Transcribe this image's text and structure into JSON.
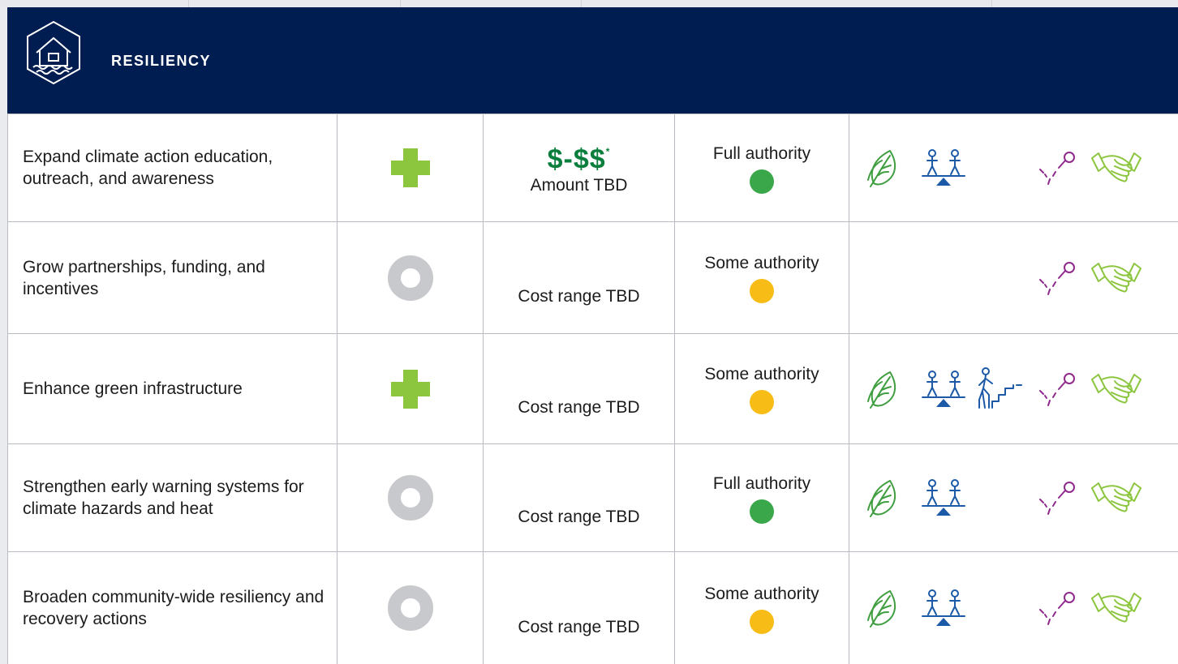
{
  "header": {
    "title": "RESILIENCY",
    "icon": "house-flood-icon",
    "background": "#001d52"
  },
  "colors": {
    "plus": "#8cc63f",
    "ring": "#c8c9cc",
    "cost_green": "#0a7f3d",
    "full_authority": "#3aa84a",
    "some_authority": "#f7bd16",
    "leaf": "#3f9e3f",
    "equity": "#1c5aa8",
    "target": "#8f2a8c",
    "handshake": "#8cc63f"
  },
  "rows": [
    {
      "action": "Expand climate action education, outreach, and awareness",
      "effect": "plus-icon",
      "cost_symbol": "$-$$",
      "cost_footnote": "*",
      "cost": "Amount TBD",
      "authority": "Full authority",
      "authority_level": "full",
      "icons": [
        "leaf-icon",
        "equity-scale-icon",
        "target-icon",
        "handshake-icon"
      ]
    },
    {
      "action": "Grow partnerships, funding, and incentives",
      "effect": "ring-icon",
      "cost_symbol": "",
      "cost_footnote": "",
      "cost": "Cost range TBD",
      "authority": "Some authority",
      "authority_level": "some",
      "icons": [
        "target-icon",
        "handshake-icon"
      ]
    },
    {
      "action": "Enhance green infrastructure",
      "effect": "plus-icon",
      "cost_symbol": "",
      "cost_footnote": "",
      "cost": "Cost range TBD",
      "authority": "Some authority",
      "authority_level": "some",
      "icons": [
        "leaf-icon",
        "equity-scale-icon",
        "person-stairs-icon",
        "target-icon",
        "handshake-icon"
      ]
    },
    {
      "action": "Strengthen early warning systems for climate hazards and heat",
      "effect": "ring-icon",
      "cost_symbol": "",
      "cost_footnote": "",
      "cost": "Cost range TBD",
      "authority": "Full authority",
      "authority_level": "full",
      "icons": [
        "leaf-icon",
        "equity-scale-icon",
        "target-icon",
        "handshake-icon"
      ]
    },
    {
      "action": "Broaden community-wide resiliency and recovery actions",
      "effect": "ring-icon",
      "cost_symbol": "",
      "cost_footnote": "",
      "cost": "Cost range TBD",
      "authority": "Some authority",
      "authority_level": "some",
      "icons": [
        "leaf-icon",
        "equity-scale-icon",
        "target-icon",
        "handshake-icon"
      ]
    }
  ]
}
